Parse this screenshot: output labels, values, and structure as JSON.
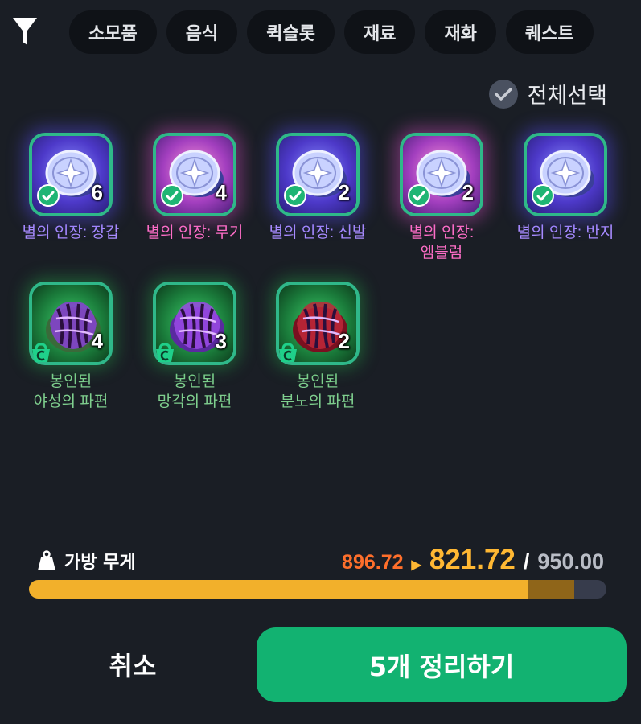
{
  "tabs": [
    {
      "label": "소모품",
      "active": true
    },
    {
      "label": "음식",
      "active": false
    },
    {
      "label": "퀵슬롯",
      "active": false
    },
    {
      "label": "재료",
      "active": false
    },
    {
      "label": "재화",
      "active": false
    },
    {
      "label": "퀘스트",
      "active": false
    }
  ],
  "select_all": {
    "label": "전체선택",
    "checked": true
  },
  "items": [
    {
      "name": "별의 인장: 장갑",
      "count": "6",
      "frame": "blue",
      "name_color": "purple",
      "selected": true,
      "icon": "star-seal-icon"
    },
    {
      "name": "별의 인장: 무기",
      "count": "4",
      "frame": "pink",
      "name_color": "pink",
      "selected": true,
      "icon": "star-seal-icon"
    },
    {
      "name": "별의 인장: 신발",
      "count": "2",
      "frame": "blue",
      "name_color": "purple",
      "selected": true,
      "icon": "star-seal-icon"
    },
    {
      "name": "별의 인장:\n엠블럼",
      "count": "2",
      "frame": "pink",
      "name_color": "pink",
      "selected": true,
      "icon": "star-seal-icon"
    },
    {
      "name": "별의 인장: 반지",
      "count": "",
      "frame": "blue",
      "name_color": "purple",
      "selected": true,
      "icon": "star-seal-icon"
    },
    {
      "name": "봉인된\n야성의 파편",
      "count": "4",
      "frame": "green",
      "name_color": "green",
      "selected": false,
      "icon": "sealed-shard-icon",
      "shard_color": "#8a3fd6",
      "shard_base": "#3a6a3a"
    },
    {
      "name": "봉인된\n망각의 파편",
      "count": "3",
      "frame": "green",
      "name_color": "green",
      "selected": false,
      "icon": "sealed-shard-icon",
      "shard_color": "#9b4ae6",
      "shard_base": "#5a2aa0"
    },
    {
      "name": "봉인된\n분노의 파편",
      "count": "2",
      "frame": "green",
      "name_color": "green",
      "selected": false,
      "icon": "sealed-shard-icon",
      "shard_color": "#c0283a",
      "shard_base": "#7a1020"
    }
  ],
  "weight": {
    "label": "가방 무게",
    "before": "896.72",
    "after": "821.72",
    "max": "950.00",
    "after_fraction": 0.865,
    "before_fraction": 0.944
  },
  "buttons": {
    "cancel": "취소",
    "confirm": "5개 정리하기"
  },
  "colors": {
    "accent_green": "#12b271",
    "weight_before": "#ff6f2b",
    "weight_after": "#ffb833"
  }
}
